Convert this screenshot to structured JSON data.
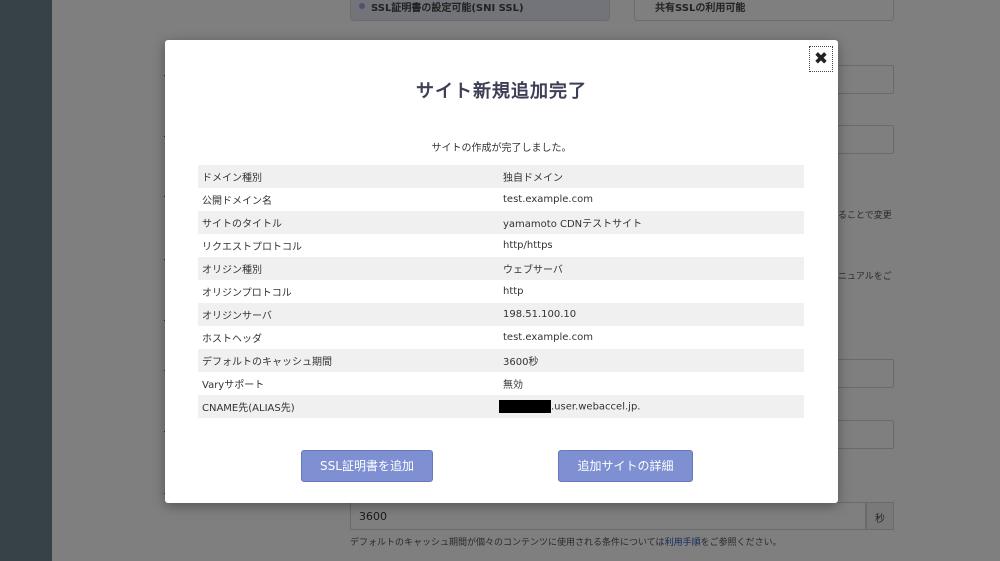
{
  "background": {
    "options": [
      {
        "label": "SSL証明書の設定可能(SNI SSL)"
      },
      {
        "label": "共有SSLの利用可能"
      }
    ],
    "side_notes": {
      "note1": "ることで変更",
      "note2_link": "ニュアル",
      "note2_suffix": "をご"
    },
    "cache": {
      "value": "3600",
      "unit": "秒",
      "note_prefix": "デフォルトのキャッシュ期間が個々のコンテンツに使用される条件については",
      "note_link": "利用手順",
      "note_suffix": "をご参照ください。"
    }
  },
  "modal": {
    "close_label": "✖",
    "title": "サイト新規追加完了",
    "message": "サイトの作成が完了しました。",
    "rows": [
      {
        "label": "ドメイン種別",
        "value": "独自ドメイン"
      },
      {
        "label": "公開ドメイン名",
        "value": "test.example.com"
      },
      {
        "label": "サイトのタイトル",
        "value": "yamamoto CDNテストサイト"
      },
      {
        "label": "リクエストプロトコル",
        "value": "http/https"
      },
      {
        "label": "オリジン種別",
        "value": "ウェブサーバ"
      },
      {
        "label": "オリジンプロトコル",
        "value": "http"
      },
      {
        "label": "オリジンサーバ",
        "value": "198.51.100.10"
      },
      {
        "label": "ホストヘッダ",
        "value": "test.example.com"
      },
      {
        "label": "デフォルトのキャッシュ期間",
        "value": "3600秒"
      },
      {
        "label": "Varyサポート",
        "value": "無効"
      },
      {
        "label": "CNAME先(ALIAS先)",
        "value": ".user.webaccel.jp."
      }
    ],
    "buttons": {
      "add_ssl": "SSL証明書を追加",
      "site_detail": "追加サイトの詳細"
    }
  }
}
